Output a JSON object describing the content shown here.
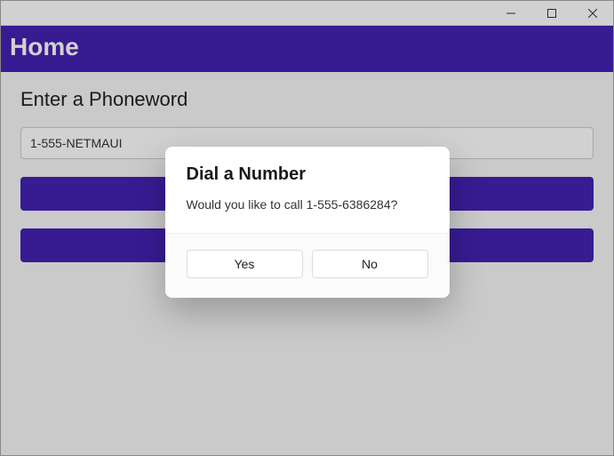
{
  "titlebar": {
    "title": ""
  },
  "header": {
    "title": "Home"
  },
  "main": {
    "prompt": "Enter a Phoneword",
    "input_value": "1-555-NETMAUI",
    "translate_label": "",
    "call_label": ""
  },
  "dialog": {
    "title": "Dial a Number",
    "message": "Would you like to call 1-555-6386284?",
    "yes_label": "Yes",
    "no_label": "No"
  },
  "colors": {
    "accent": "#4421b3"
  }
}
